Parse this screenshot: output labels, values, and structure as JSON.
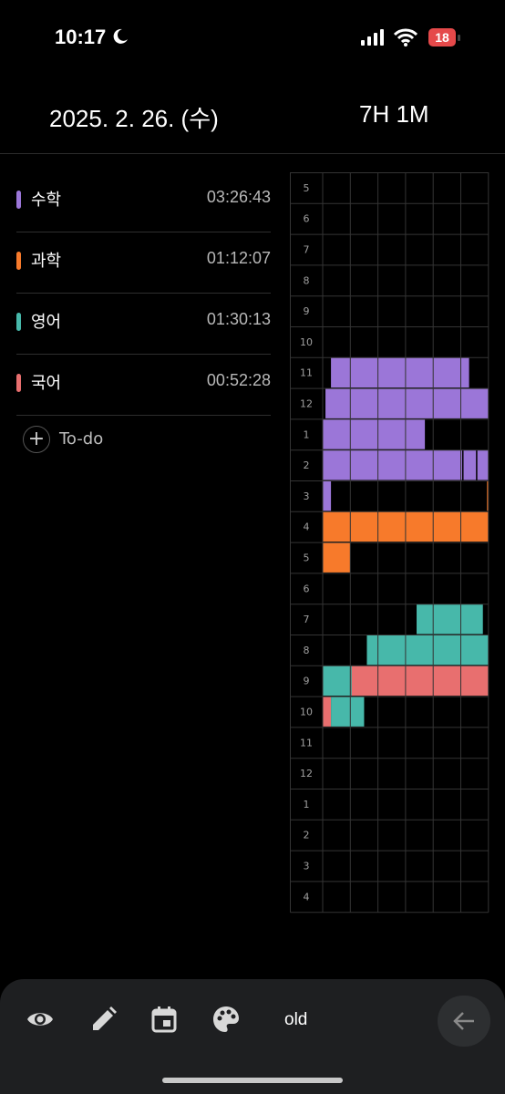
{
  "status_bar": {
    "time": "10:17",
    "battery": "18"
  },
  "header": {
    "date": "2025. 2. 26. (수)",
    "total": "7H 1M"
  },
  "subjects": [
    {
      "name": "수학",
      "time": "03:26:43",
      "color": "#9b76d8"
    },
    {
      "name": "과학",
      "time": "01:12:07",
      "color": "#f77a2b"
    },
    {
      "name": "영어",
      "time": "01:30:13",
      "color": "#47b8aa"
    },
    {
      "name": "국어",
      "time": "00:52:28",
      "color": "#e86f6f"
    }
  ],
  "todo": {
    "label": "To-do"
  },
  "timetable": {
    "hours": [
      "5",
      "6",
      "7",
      "8",
      "9",
      "10",
      "11",
      "12",
      "1",
      "2",
      "3",
      "4",
      "5",
      "6",
      "7",
      "8",
      "9",
      "10",
      "11",
      "12",
      "1",
      "2",
      "3",
      "4"
    ],
    "blocks": [
      {
        "row": 6,
        "start": 0.3,
        "end": 5.3,
        "subject": 0
      },
      {
        "row": 7,
        "start": 0.1,
        "end": 6.0,
        "subject": 0
      },
      {
        "row": 8,
        "start": 0.0,
        "end": 3.7,
        "subject": 0
      },
      {
        "row": 9,
        "start": 0.0,
        "end": 5.05,
        "subject": 0
      },
      {
        "row": 9,
        "start": 5.1,
        "end": 5.55,
        "subject": 0
      },
      {
        "row": 9,
        "start": 5.6,
        "end": 6.0,
        "subject": 0
      },
      {
        "row": 10,
        "start": 0.0,
        "end": 0.3,
        "subject": 0
      },
      {
        "row": 10,
        "start": 5.95,
        "end": 6.0,
        "subject": 1
      },
      {
        "row": 11,
        "start": 0.0,
        "end": 6.0,
        "subject": 1
      },
      {
        "row": 12,
        "start": 0.0,
        "end": 1.0,
        "subject": 1
      },
      {
        "row": 14,
        "start": 3.4,
        "end": 5.8,
        "subject": 2
      },
      {
        "row": 15,
        "start": 1.6,
        "end": 6.0,
        "subject": 2
      },
      {
        "row": 16,
        "start": 0.0,
        "end": 1.05,
        "subject": 2
      },
      {
        "row": 16,
        "start": 1.05,
        "end": 6.0,
        "subject": 3
      },
      {
        "row": 17,
        "start": 0.0,
        "end": 0.3,
        "subject": 3
      },
      {
        "row": 17,
        "start": 0.3,
        "end": 1.5,
        "subject": 2
      }
    ]
  },
  "bottom_bar": {
    "icons": [
      "eye-icon",
      "pencil-icon",
      "calendar-icon",
      "palette-icon"
    ],
    "old_label": "old",
    "back_icon": "arrow-left-icon"
  }
}
